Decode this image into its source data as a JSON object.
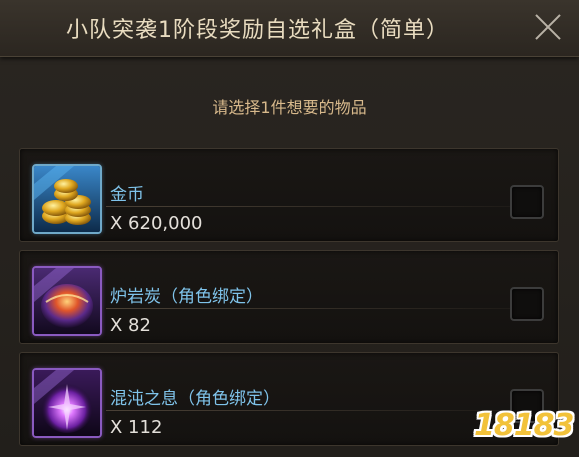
{
  "dialog": {
    "title": "小队突袭1阶段奖励自选礼盒（简单）",
    "subtitle": "请选择1件想要的物品",
    "close_icon": "close-icon"
  },
  "items": [
    {
      "name": "金币",
      "quantity": "X 620,000",
      "icon": "gold-coins-icon",
      "frame_color": "#6fa9c9",
      "checked": false
    },
    {
      "name": "炉岩炭（角色绑定）",
      "quantity": "X 82",
      "icon": "lava-coal-icon",
      "frame_color": "#8a5ac0",
      "checked": false
    },
    {
      "name": "混沌之息（角色绑定）",
      "quantity": "X 112",
      "icon": "chaos-breath-icon",
      "frame_color": "#8a5ac0",
      "checked": false
    }
  ],
  "watermark": {
    "text": "18183"
  }
}
